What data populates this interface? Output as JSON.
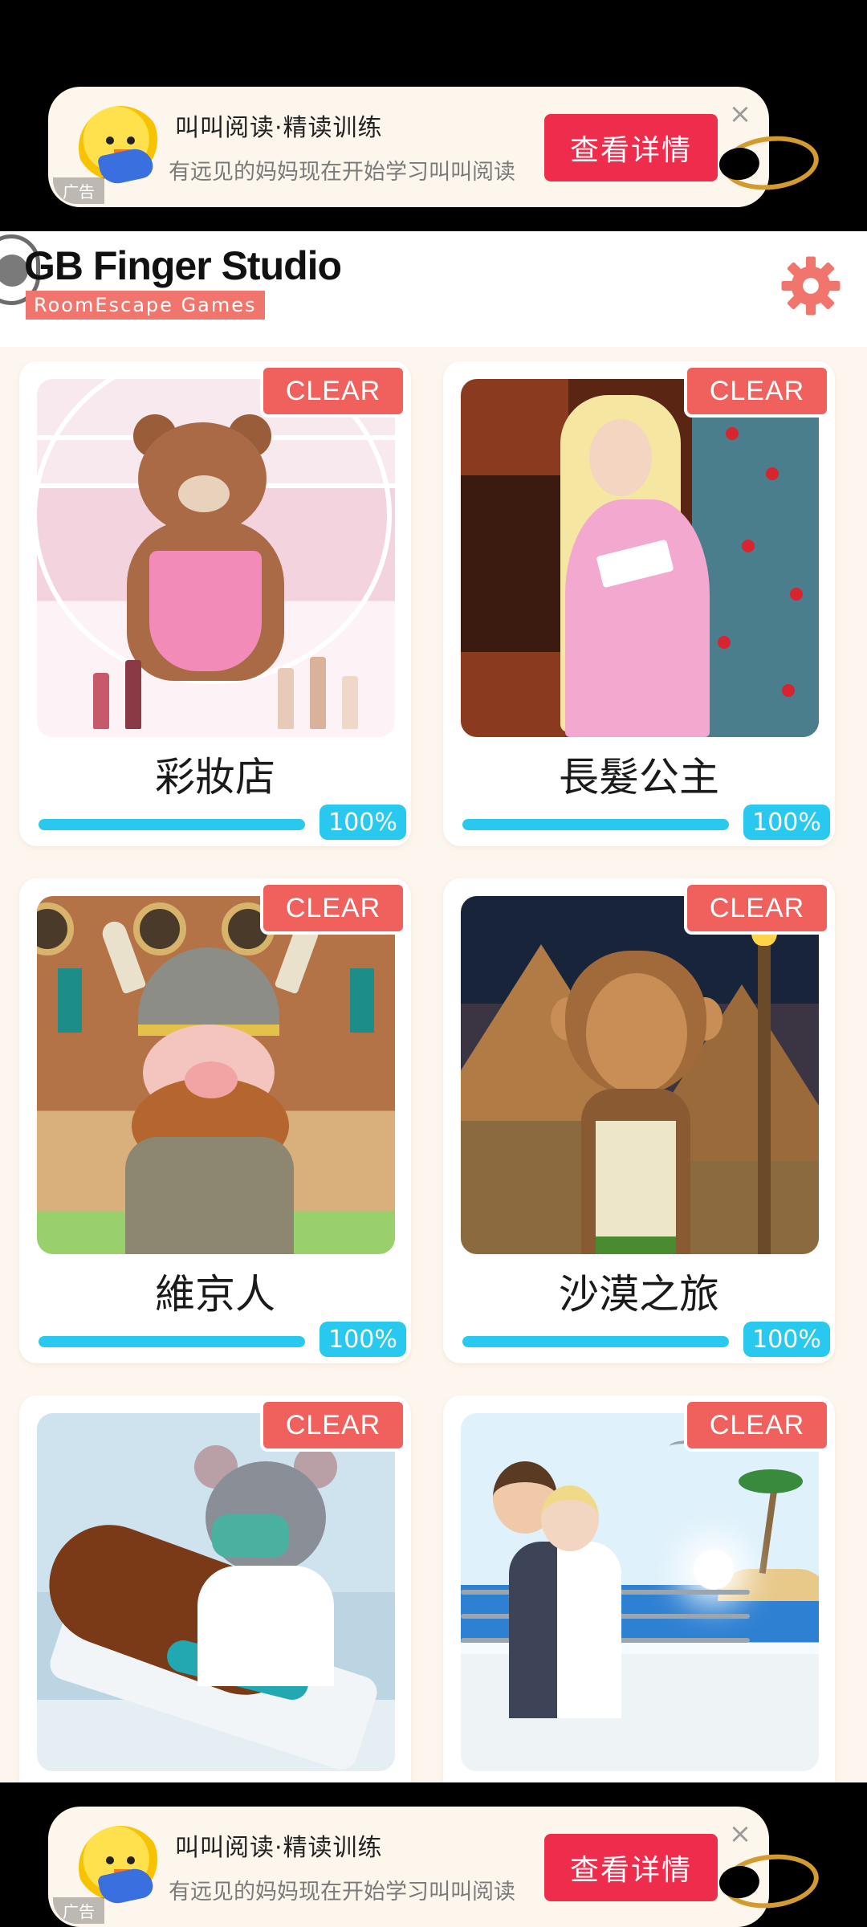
{
  "ads": {
    "top": {
      "label": "广告",
      "title": "叫叫阅读·精读训练",
      "description": "有远见的妈妈现在开始学习叫叫阅读",
      "cta": "查看详情",
      "close": "×",
      "mascot_icon": "chick-mascot-icon"
    },
    "bottom": {
      "label": "广告",
      "title": "叫叫阅读·精读训练",
      "description": "有远见的妈妈现在开始学习叫叫阅读",
      "cta": "查看详情",
      "close": "×",
      "mascot_icon": "chick-mascot-icon"
    }
  },
  "header": {
    "studio_name": "GB Finger Studio",
    "tagline": "RoomEscape  Games",
    "settings_icon": "gear-icon"
  },
  "colors": {
    "accent_red": "#f0615d",
    "progress_blue": "#29c8ef",
    "ad_cta_red": "#ee2c4c",
    "content_bg": "#fdf6ee"
  },
  "games": [
    {
      "title": "彩妝店",
      "badge": "CLEAR",
      "progress": 1.0,
      "progress_label": "100%"
    },
    {
      "title": "長髮公主",
      "badge": "CLEAR",
      "progress": 1.0,
      "progress_label": "100%"
    },
    {
      "title": "維京人",
      "badge": "CLEAR",
      "progress": 1.0,
      "progress_label": "100%"
    },
    {
      "title": "沙漠之旅",
      "badge": "CLEAR",
      "progress": 1.0,
      "progress_label": "100%"
    },
    {
      "title": "",
      "badge": "CLEAR",
      "progress": null,
      "progress_label": ""
    },
    {
      "title": "",
      "badge": "CLEAR",
      "progress": null,
      "progress_label": ""
    }
  ]
}
